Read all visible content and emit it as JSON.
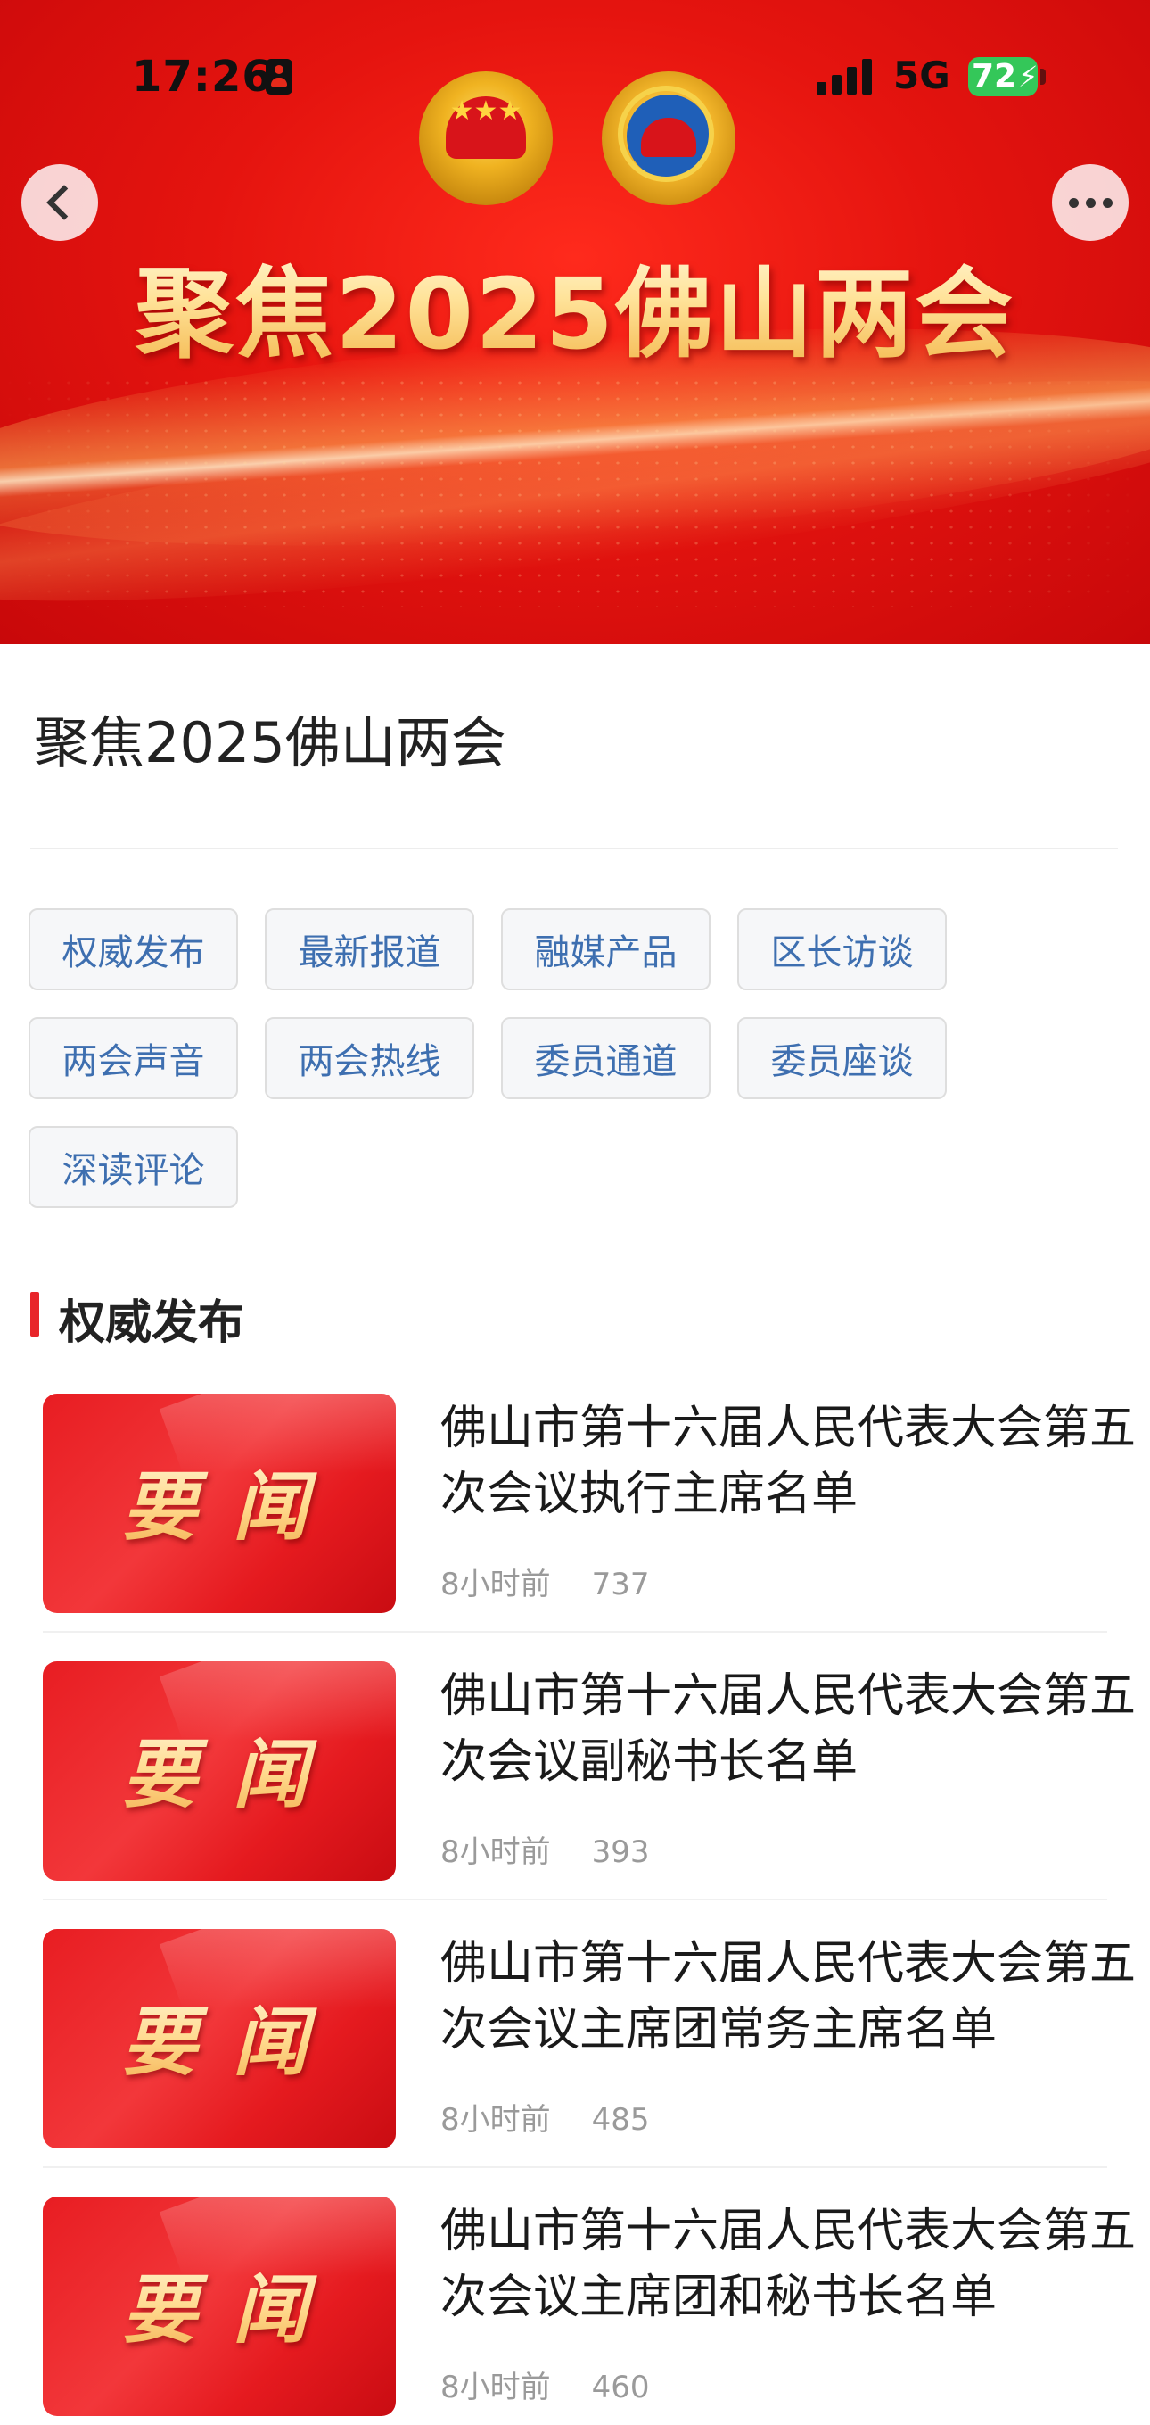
{
  "status_bar": {
    "time": "17:26",
    "network": "5G",
    "battery": "72"
  },
  "hero": {
    "title": "聚焦2025佛山两会"
  },
  "page": {
    "title": "聚焦2025佛山两会"
  },
  "tags": [
    {
      "label": "权威发布"
    },
    {
      "label": "最新报道"
    },
    {
      "label": "融媒产品"
    },
    {
      "label": "区长访谈"
    },
    {
      "label": "两会声音"
    },
    {
      "label": "两会热线"
    },
    {
      "label": "委员通道"
    },
    {
      "label": "委员座谈"
    },
    {
      "label": "深读评论"
    }
  ],
  "section": {
    "title": "权威发布"
  },
  "news": [
    {
      "thumb": "要闻",
      "title": "佛山市第十六届人民代表大会第五次会议执行主席名单",
      "time": "8小时前",
      "views": "737"
    },
    {
      "thumb": "要闻",
      "title": "佛山市第十六届人民代表大会第五次会议副秘书长名单",
      "time": "8小时前",
      "views": "393"
    },
    {
      "thumb": "要闻",
      "title": "佛山市第十六届人民代表大会第五次会议主席团常务主席名单",
      "time": "8小时前",
      "views": "485"
    },
    {
      "thumb": "要闻",
      "title": "佛山市第十六届人民代表大会第五次会议主席团和秘书长名单",
      "time": "8小时前",
      "views": "460"
    }
  ],
  "icons": [
    "back-chevron-icon",
    "more-dots-icon",
    "signal-icon",
    "battery-icon",
    "national-emblem-icon",
    "cppcc-emblem-icon"
  ]
}
